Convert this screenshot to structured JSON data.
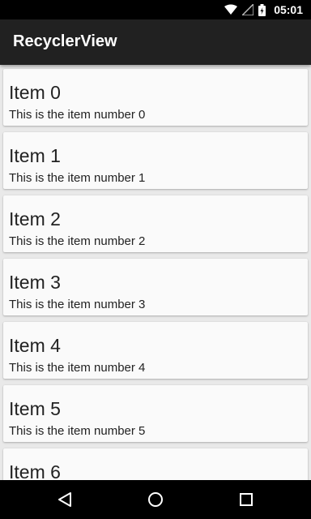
{
  "status_bar": {
    "time": "05:01",
    "icons": [
      "wifi-icon",
      "cell-signal-icon",
      "battery-icon"
    ]
  },
  "app_bar": {
    "title": "RecyclerView"
  },
  "items": [
    {
      "title": "Item 0",
      "subtitle": "This is the item number 0"
    },
    {
      "title": "Item 1",
      "subtitle": "This is the item number 1"
    },
    {
      "title": "Item 2",
      "subtitle": "This is the item number 2"
    },
    {
      "title": "Item 3",
      "subtitle": "This is the item number 3"
    },
    {
      "title": "Item 4",
      "subtitle": "This is the item number 4"
    },
    {
      "title": "Item 5",
      "subtitle": "This is the item number 5"
    },
    {
      "title": "Item 6",
      "subtitle": ""
    }
  ],
  "nav_bar": {
    "buttons": [
      "back-icon",
      "home-icon",
      "recents-icon"
    ]
  },
  "colors": {
    "status_bar": "#000000",
    "app_bar": "#212121",
    "background": "#e9e9e9",
    "card": "#fafafa",
    "text": "#222222"
  }
}
